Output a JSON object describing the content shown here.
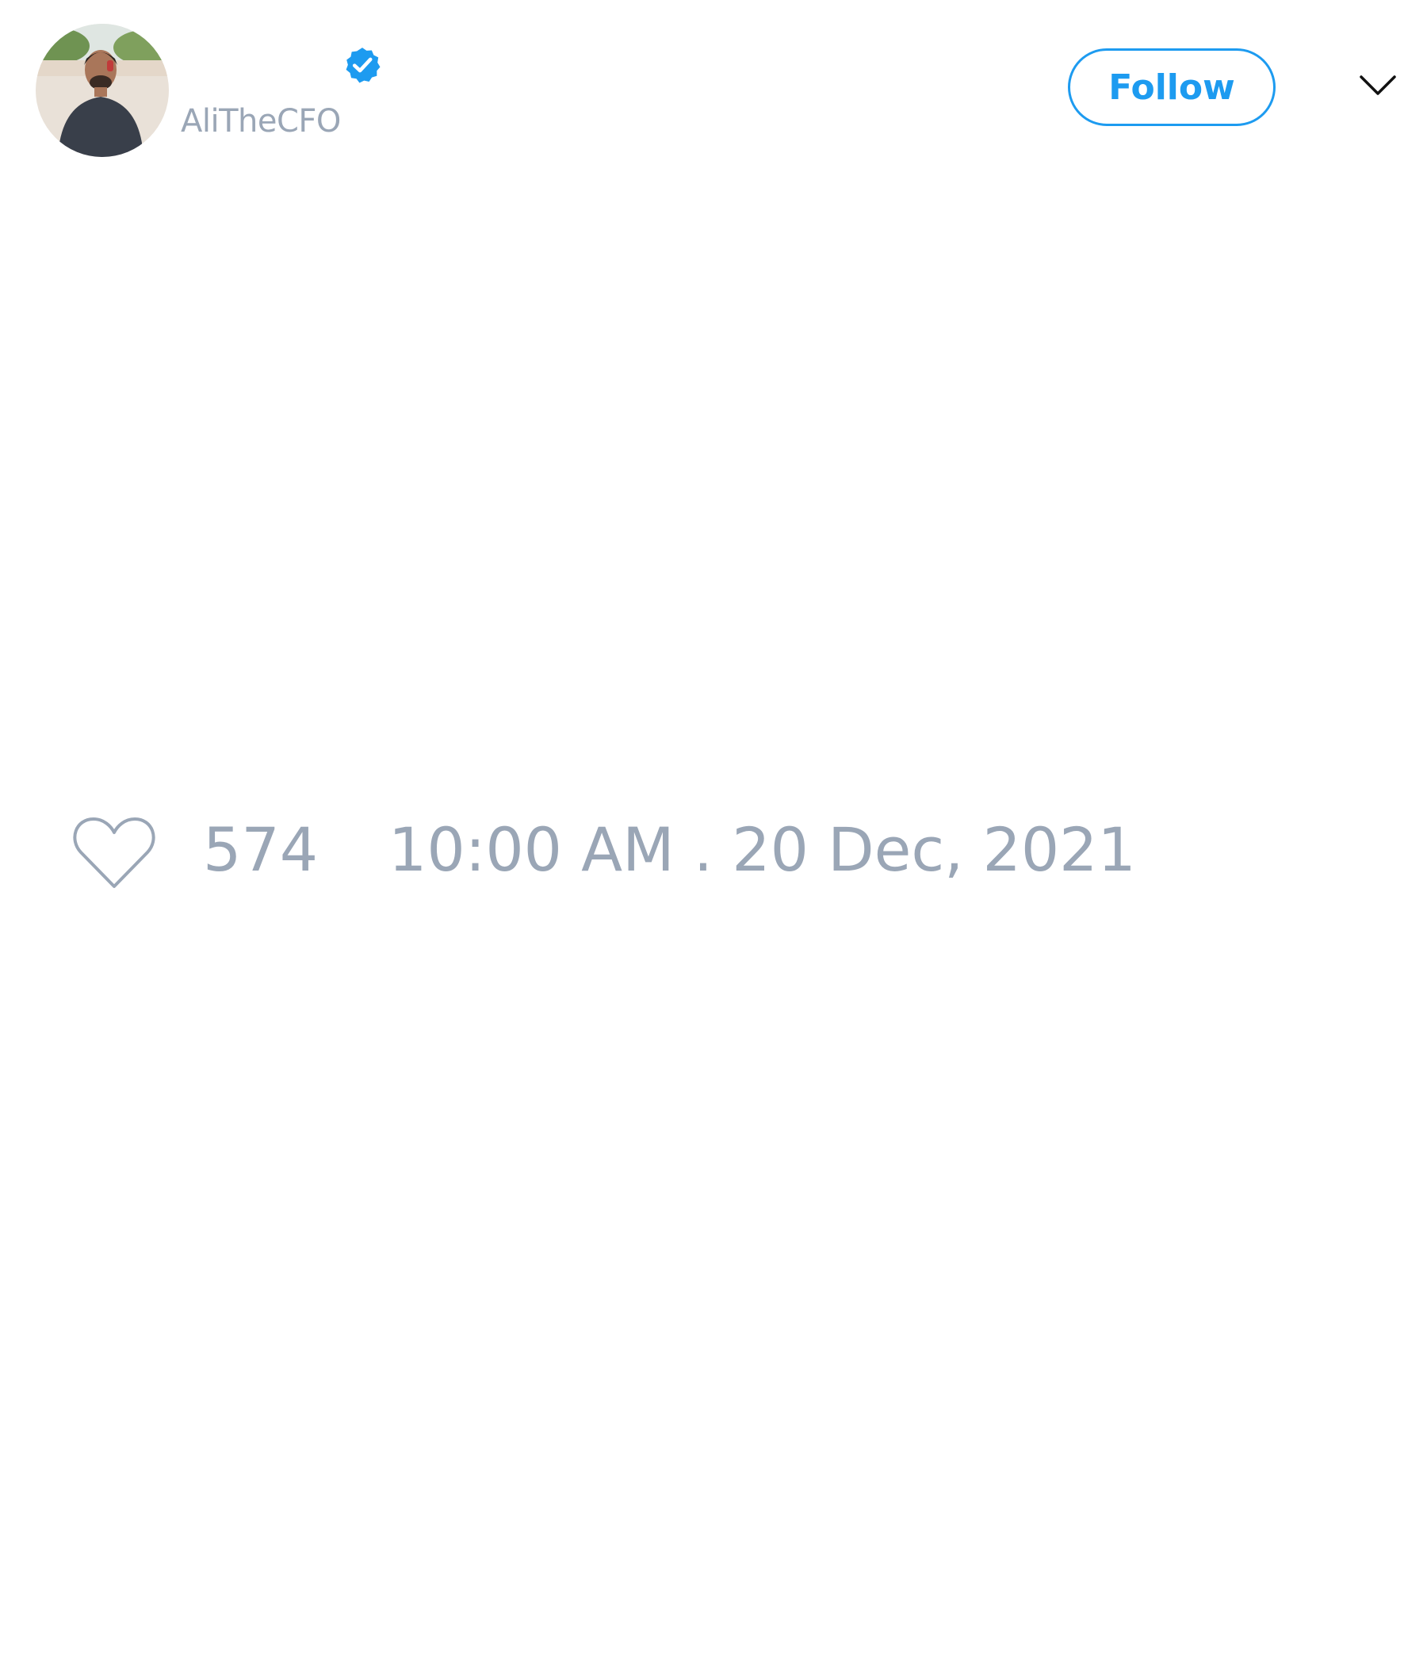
{
  "tweet": {
    "author": {
      "handle": "AliTheCFO",
      "verified": true,
      "avatar_icon": "profile-photo"
    },
    "follow_label": "Follow",
    "menu_icon": "chevron-down-icon",
    "likes": "574",
    "timestamp": "10:00 AM . 20 Dec, 2021"
  },
  "colors": {
    "accent": "#1d9bf0",
    "muted_text": "#9aa6b6"
  }
}
